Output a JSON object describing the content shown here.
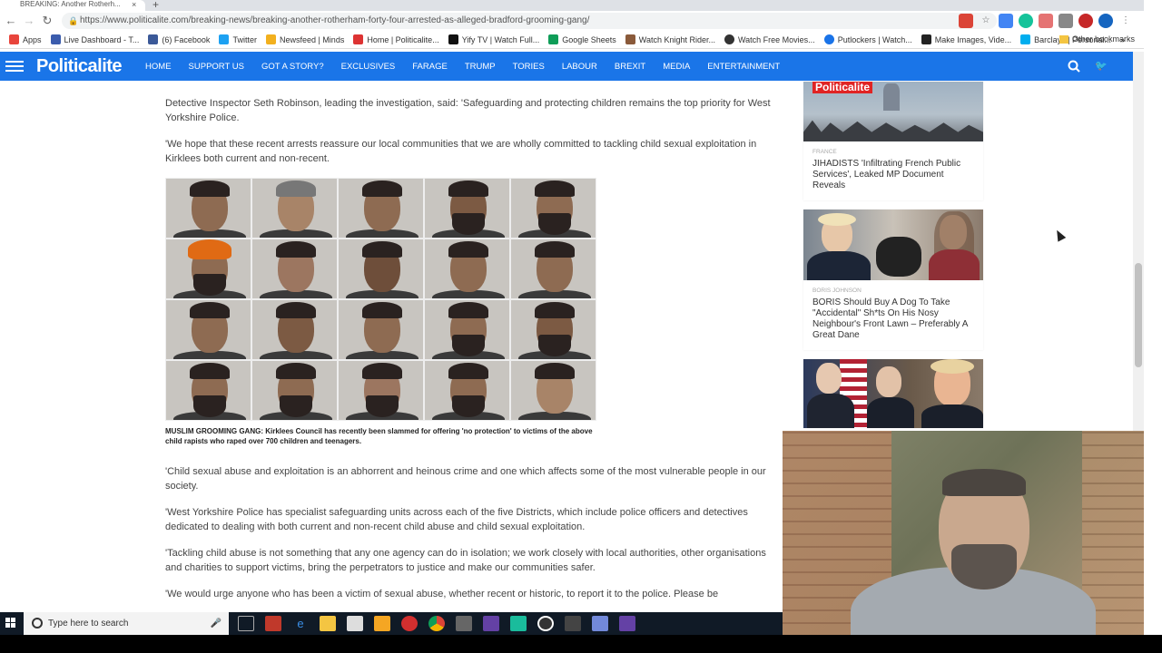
{
  "browser": {
    "tab_title": "BREAKING: Another Rotherh...",
    "tab_close": "×",
    "new_tab": "+",
    "url": "https://www.politicalite.com/breaking-news/breaking-another-rotherham-forty-four-arrested-as-alleged-bradford-grooming-gang/",
    "bookmarks": [
      {
        "label": "Apps",
        "color": "#e8453c"
      },
      {
        "label": "Live Dashboard - T...",
        "color": "#3b5cad"
      },
      {
        "label": "(6) Facebook",
        "color": "#3b5998"
      },
      {
        "label": "Twitter",
        "color": "#1da1f2"
      },
      {
        "label": "Newsfeed | Minds",
        "color": "#f2b01e"
      },
      {
        "label": "Home | Politicalite...",
        "color": "#d33"
      },
      {
        "label": "Yify TV | Watch Full...",
        "color": "#111"
      },
      {
        "label": "Google Sheets",
        "color": "#0f9d58"
      },
      {
        "label": "Watch Knight Rider...",
        "color": "#8a5a3a"
      },
      {
        "label": "Watch Free Movies...",
        "color": "#333"
      },
      {
        "label": "Putlockers | Watch...",
        "color": "#1a73e8"
      },
      {
        "label": "Make Images, Vide...",
        "color": "#222"
      },
      {
        "label": "Barclays | Personal...",
        "color": "#00aeef"
      }
    ],
    "bookmarks_more": "»",
    "other_bookmarks": "Other bookmarks"
  },
  "site": {
    "logo": "Politicalite",
    "menu": [
      "HOME",
      "SUPPORT US",
      "GOT A STORY?",
      "EXCLUSIVES",
      "FARAGE",
      "TRUMP",
      "TORIES",
      "LABOUR",
      "BREXIT",
      "MEDIA",
      "ENTERTAINMENT"
    ]
  },
  "article": {
    "p1": "Detective Inspector Seth Robinson, leading the investigation, said: 'Safeguarding and protecting children remains the top priority for West Yorkshire Police.",
    "p2": "'We hope that these recent arrests reassure our local communities that we are wholly committed to tackling child sexual exploitation in Kirklees both current and non-recent.",
    "caption": "MUSLIM GROOMING GANG: Kirklees Council has recently been slammed for offering 'no protection' to victims of the above child rapists who raped over 700 children and teenagers.",
    "p3": "'Child sexual abuse and exploitation is an abhorrent and heinous crime and one which affects some of the most vulnerable people in our society.",
    "p4": "'West Yorkshire Police has specialist safeguarding units across each of the five Districts, which include police officers and detectives dedicated to dealing with both current and non-recent child abuse and child sexual exploitation.",
    "p5": "'Tackling child abuse is not something that any one agency can do in isolation; we work closely with local authorities, other organisations and charities to support victims, bring the perpetrators to justice and make our communities safer.",
    "p6": "'We would urge anyone who has been a victim of sexual abuse, whether recent or historic, to report it to the police. Please be"
  },
  "sidebar": {
    "cards": [
      {
        "badge": "Politicalite",
        "category": "FRANCE",
        "title": "JIHADISTS 'Infiltrating French Public Services', Leaked MP Document Reveals"
      },
      {
        "badge": "",
        "category": "BORIS JOHNSON",
        "title": "BORIS Should Buy A Dog To Take \"Accidental\" Sh*ts On His Nosy Neighbour's Front Lawn – Preferably A Great Dane"
      },
      {
        "badge": "",
        "category": "",
        "title": ""
      }
    ]
  },
  "taskbar": {
    "search_placeholder": "Type here to search"
  }
}
